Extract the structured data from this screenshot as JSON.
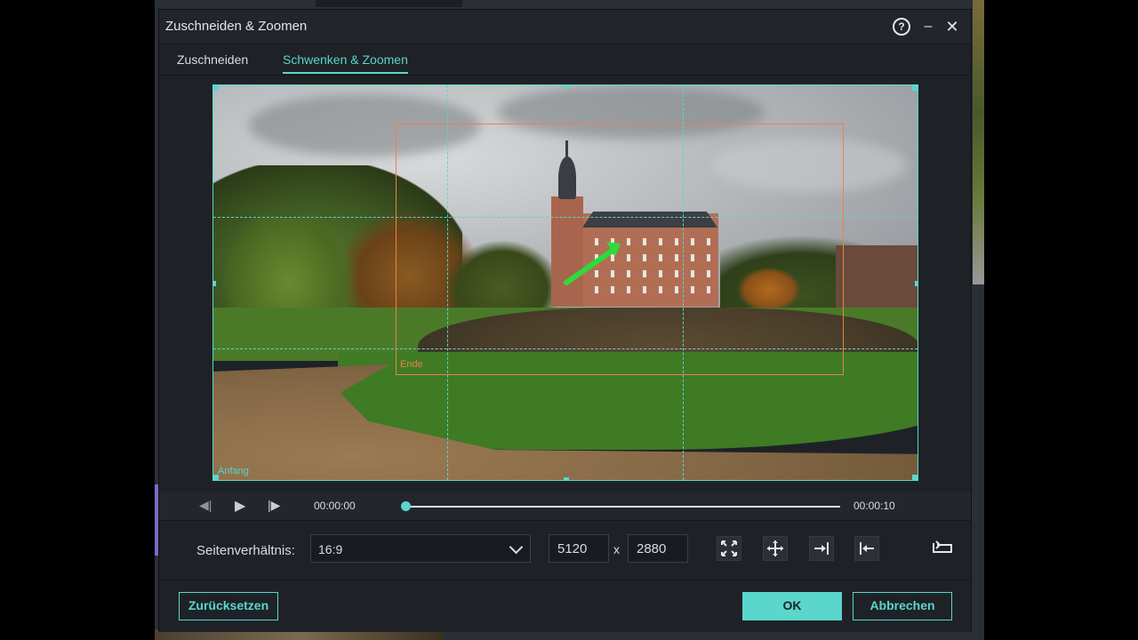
{
  "dialog": {
    "title": "Zuschneiden & Zoomen",
    "help_glyph": "?",
    "minimize_glyph": "–",
    "close_glyph": "✕"
  },
  "tabs": [
    {
      "label": "Zuschneiden",
      "active": false
    },
    {
      "label": "Schwenken & Zoomen",
      "active": true
    }
  ],
  "preview": {
    "start_label": "Anfang",
    "end_label": "Ende"
  },
  "transport": {
    "prev_glyph": "◀|",
    "play_glyph": "▶",
    "next_glyph": "|▶",
    "current_time": "00:00:00",
    "end_time": "00:00:10",
    "progress": 0
  },
  "controls": {
    "aspect_label": "Seitenverhältnis:",
    "aspect_value": "16:9",
    "width": "5120",
    "separator": "x",
    "height": "2880",
    "icons": [
      "fit-icon",
      "move-icon",
      "arrow-right-icon",
      "arrow-left-icon",
      "swap-icon"
    ]
  },
  "footer": {
    "reset_label": "Zurücksetzen",
    "ok_label": "OK",
    "cancel_label": "Abbrechen"
  },
  "colors": {
    "accent": "#5ad6cb",
    "end_frame": "#e8834a",
    "dialog_bg": "#1e2227"
  }
}
